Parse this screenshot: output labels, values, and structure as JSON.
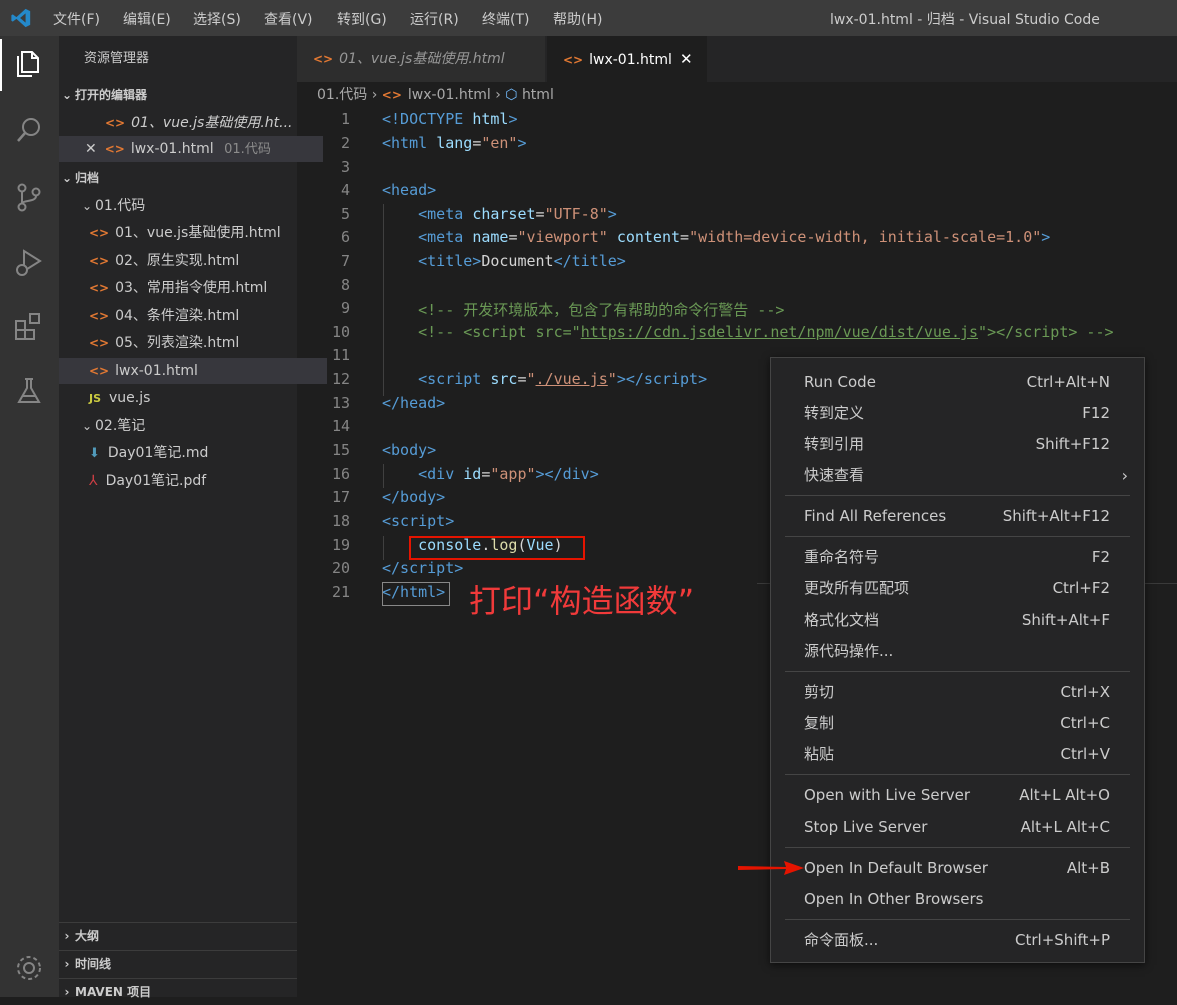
{
  "window": {
    "title": "lwx-01.html - 归档 - Visual Studio Code",
    "menu": [
      "文件(F)",
      "编辑(E)",
      "选择(S)",
      "查看(V)",
      "转到(G)",
      "运行(R)",
      "终端(T)",
      "帮助(H)"
    ]
  },
  "activity_bar": {
    "icons": [
      "explorer-icon",
      "search-icon",
      "source-control-icon",
      "run-debug-icon",
      "extensions-icon",
      "testing-icon",
      "settings-gear-icon"
    ]
  },
  "sidebar": {
    "title": "资源管理器",
    "open_editors_header": "打开的编辑器",
    "open_editors": [
      {
        "name": "01、vue.js基础使用.ht...",
        "folder": ""
      },
      {
        "name": "lwx-01.html",
        "folder": "01.代码"
      }
    ],
    "workspace_header": "归档",
    "folder1": "01.代码",
    "folder1_files": [
      "01、vue.js基础使用.html",
      "02、原生实现.html",
      "03、常用指令使用.html",
      "04、条件渲染.html",
      "05、列表渲染.html",
      "lwx-01.html",
      "vue.js"
    ],
    "folder2": "02.笔记",
    "folder2_files": [
      "Day01笔记.md",
      "Day01笔记.pdf"
    ],
    "bottom_sections": [
      "大纲",
      "时间线",
      "MAVEN 项目"
    ]
  },
  "tabs": {
    "inactive": "01、vue.js基础使用.html",
    "active": "lwx-01.html",
    "close_glyph": "✕"
  },
  "breadcrumb": [
    "01.代码",
    "lwx-01.html",
    "html"
  ],
  "editor": {
    "line_numbers": [
      "1",
      "2",
      "3",
      "4",
      "5",
      "6",
      "7",
      "8",
      "9",
      "10",
      "11",
      "12",
      "13",
      "14",
      "15",
      "16",
      "17",
      "18",
      "19",
      "20",
      "21"
    ],
    "annotation": "打印“构造函数”"
  },
  "context_menu": {
    "groups": [
      [
        {
          "label": "Run Code",
          "key": "Ctrl+Alt+N"
        },
        {
          "label": "转到定义",
          "key": "F12"
        },
        {
          "label": "转到引用",
          "key": "Shift+F12"
        },
        {
          "label": "快速查看",
          "key": "",
          "submenu": true
        }
      ],
      [
        {
          "label": "Find All References",
          "key": "Shift+Alt+F12"
        }
      ],
      [
        {
          "label": "重命名符号",
          "key": "F2"
        },
        {
          "label": "更改所有匹配项",
          "key": "Ctrl+F2"
        },
        {
          "label": "格式化文档",
          "key": "Shift+Alt+F"
        },
        {
          "label": "源代码操作...",
          "key": ""
        }
      ],
      [
        {
          "label": "剪切",
          "key": "Ctrl+X"
        },
        {
          "label": "复制",
          "key": "Ctrl+C"
        },
        {
          "label": "粘贴",
          "key": "Ctrl+V"
        }
      ],
      [
        {
          "label": "Open with Live Server",
          "key": "Alt+L Alt+O"
        },
        {
          "label": "Stop Live Server",
          "key": "Alt+L Alt+C"
        }
      ],
      [
        {
          "label": "Open In Default Browser",
          "key": "Alt+B"
        },
        {
          "label": "Open In Other Browsers",
          "key": ""
        }
      ],
      [
        {
          "label": "命令面板...",
          "key": "Ctrl+Shift+P"
        }
      ]
    ]
  },
  "colors": {
    "accent_annotation": "#f03a3a",
    "html_icon": "#e37933",
    "keyword": "#569cd6",
    "attribute": "#9cdcfe",
    "string": "#ce9178",
    "comment": "#6a9955"
  }
}
